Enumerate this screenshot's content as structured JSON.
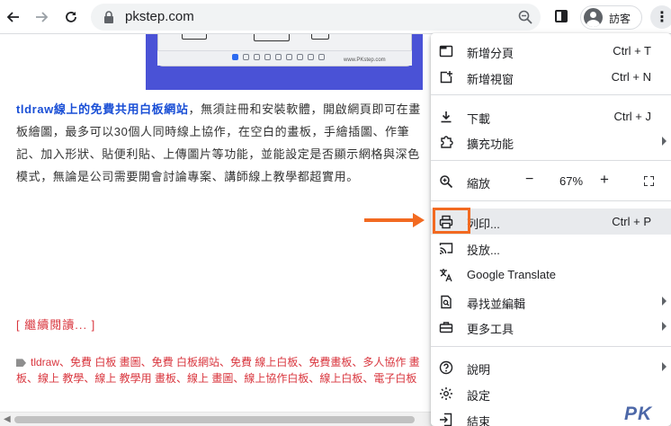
{
  "browser": {
    "url": "pkstep.com",
    "profile_name": "訪客"
  },
  "article": {
    "lead_link": "tldraw線上的免費共用白板網站",
    "body": "，無須註冊和安裝軟體，開啟網頁即可在畫板繪圖，最多可以30個人同時線上協作，在空白的畫板，手繪插圖、作筆記、加入形狀、貼便利貼、上傳圖片等功能，並能設定是否顯示網格與深色模式，無論是公司需要開會討論專案、講師線上教學都超實用。",
    "read_more": "[ 繼續閱讀... ]",
    "tags_line1": "tldraw、免費 白板 畫圖、免費 白板網站、免費 線上白板、免費畫板、多人協作 畫",
    "tags_line2": "板、線上 教學、線上 教學用 畫板、線上 畫圖、線上協作白板、線上白板、電子白板",
    "thumbnail_watermark": "www.PKstep.com"
  },
  "menu": {
    "new_tab": {
      "label": "新增分頁",
      "shortcut": "Ctrl + T"
    },
    "new_window": {
      "label": "新增視窗",
      "shortcut": "Ctrl + N"
    },
    "downloads": {
      "label": "下載",
      "shortcut": "Ctrl + J"
    },
    "extensions": {
      "label": "擴充功能"
    },
    "zoom": {
      "label": "縮放",
      "minus": "−",
      "value": "67%",
      "plus": "+"
    },
    "print": {
      "label": "列印...",
      "shortcut": "Ctrl + P"
    },
    "cast": {
      "label": "投放..."
    },
    "translate": {
      "label": "Google Translate"
    },
    "find_edit": {
      "label": "尋找並編輯"
    },
    "more_tools": {
      "label": "更多工具"
    },
    "help": {
      "label": "說明"
    },
    "settings": {
      "label": "設定"
    },
    "exit": {
      "label": "結束"
    }
  },
  "watermark": "PK",
  "colors": {
    "highlight": "#f26a21",
    "link": "#1a4fd6",
    "tag": "#d9363e",
    "thumbnail_bg": "#4a52d6"
  }
}
